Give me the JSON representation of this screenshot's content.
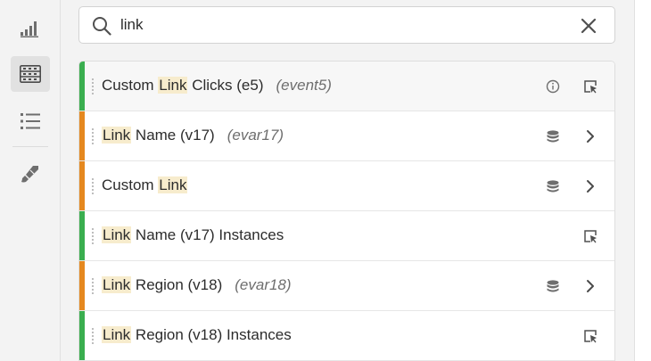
{
  "colors": {
    "event_stripe": "#3aae4f",
    "dimension_stripe": "#e5881f",
    "highlight": "#f7eccd"
  },
  "rail": {
    "items": [
      {
        "icon": "bar-chart-icon",
        "active": false
      },
      {
        "icon": "components-icon",
        "active": true
      },
      {
        "icon": "list-icon",
        "active": false
      },
      {
        "icon": "brush-icon",
        "active": false
      }
    ]
  },
  "search": {
    "value": "link",
    "placeholder": ""
  },
  "rows": [
    {
      "pre": "Custom ",
      "hl": "Link",
      "post": " Clicks (e5)",
      "sub": "(event5)",
      "kind": "event"
    },
    {
      "pre": "",
      "hl": "Link",
      "post": " Name (v17)",
      "sub": "(evar17)",
      "kind": "dimension"
    },
    {
      "pre": "Custom ",
      "hl": "Link",
      "post": "",
      "sub": "",
      "kind": "dimension"
    },
    {
      "pre": "",
      "hl": "Link",
      "post": " Name (v17) Instances",
      "sub": "",
      "kind": "event"
    },
    {
      "pre": "",
      "hl": "Link",
      "post": " Region (v18)",
      "sub": "(evar18)",
      "kind": "dimension"
    },
    {
      "pre": "",
      "hl": "Link",
      "post": " Region (v18) Instances",
      "sub": "",
      "kind": "event"
    }
  ]
}
